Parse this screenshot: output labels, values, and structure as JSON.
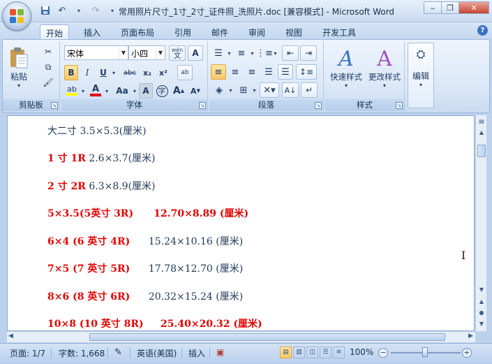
{
  "window": {
    "title": "常用照片尺寸_1寸_2寸_证件照_洗照片.doc [兼容模式] - Microsoft Word",
    "minimize_icon": "minimize-icon",
    "restore_icon": "restore-icon",
    "close_icon": "close-icon"
  },
  "quick_access": {
    "save_icon": "save-icon",
    "undo_icon": "undo-icon",
    "redo_icon": "redo-icon",
    "customize_icon": "dropdown-icon"
  },
  "tabs": [
    {
      "label": "开始",
      "active": true
    },
    {
      "label": "插入"
    },
    {
      "label": "页面布局"
    },
    {
      "label": "引用"
    },
    {
      "label": "邮件"
    },
    {
      "label": "审阅"
    },
    {
      "label": "视图"
    },
    {
      "label": "开发工具"
    }
  ],
  "ribbon": {
    "clipboard": {
      "label": "剪贴板",
      "paste": "粘贴"
    },
    "font": {
      "label": "字体",
      "font_name": "宋体",
      "font_size": "小四",
      "wen": "wén",
      "wen_char": "文",
      "a_box": "A",
      "bold": "B",
      "italic": "I",
      "underline": "U",
      "strike": "abc",
      "sub": "x₂",
      "sup": "x²",
      "aa": "Aa",
      "grow": "A",
      "shrink": "A",
      "zi": "字",
      "ab": "ab"
    },
    "paragraph": {
      "label": "段落"
    },
    "styles": {
      "label": "样式",
      "quick": "快速样式",
      "change": "更改样式"
    },
    "editing": {
      "label": "编辑"
    }
  },
  "document": {
    "lines": [
      {
        "red": "",
        "rest": "大二寸 3.5×5.3(厘米)"
      },
      {
        "red": "1 寸 1R",
        "rest": " 2.6×3.7(厘米)"
      },
      {
        "red": "2 寸 2R",
        "rest": " 6.3×8.9(厘米)"
      },
      {
        "red": "5×3.5(5英寸 3R)      12.70×8.89 (厘米)",
        "rest": ""
      },
      {
        "red": "6×4 (6 英寸 4R)",
        "rest": "      15.24×10.16 (厘米)"
      },
      {
        "red": "7×5 (7 英寸 5R)",
        "rest": "      17.78×12.70 (厘米)"
      },
      {
        "red": "8×6 (8 英寸 6R)",
        "rest": "      20.32×15.24 (厘米)"
      },
      {
        "red": "10×8 (10 英寸 8R)     25.40×20.32 (厘米)",
        "rest": ""
      }
    ]
  },
  "status": {
    "page": "页面: 1/7",
    "words": "字数: 1,668",
    "language": "英语(美国)",
    "insert": "插入",
    "zoom": "100%"
  }
}
